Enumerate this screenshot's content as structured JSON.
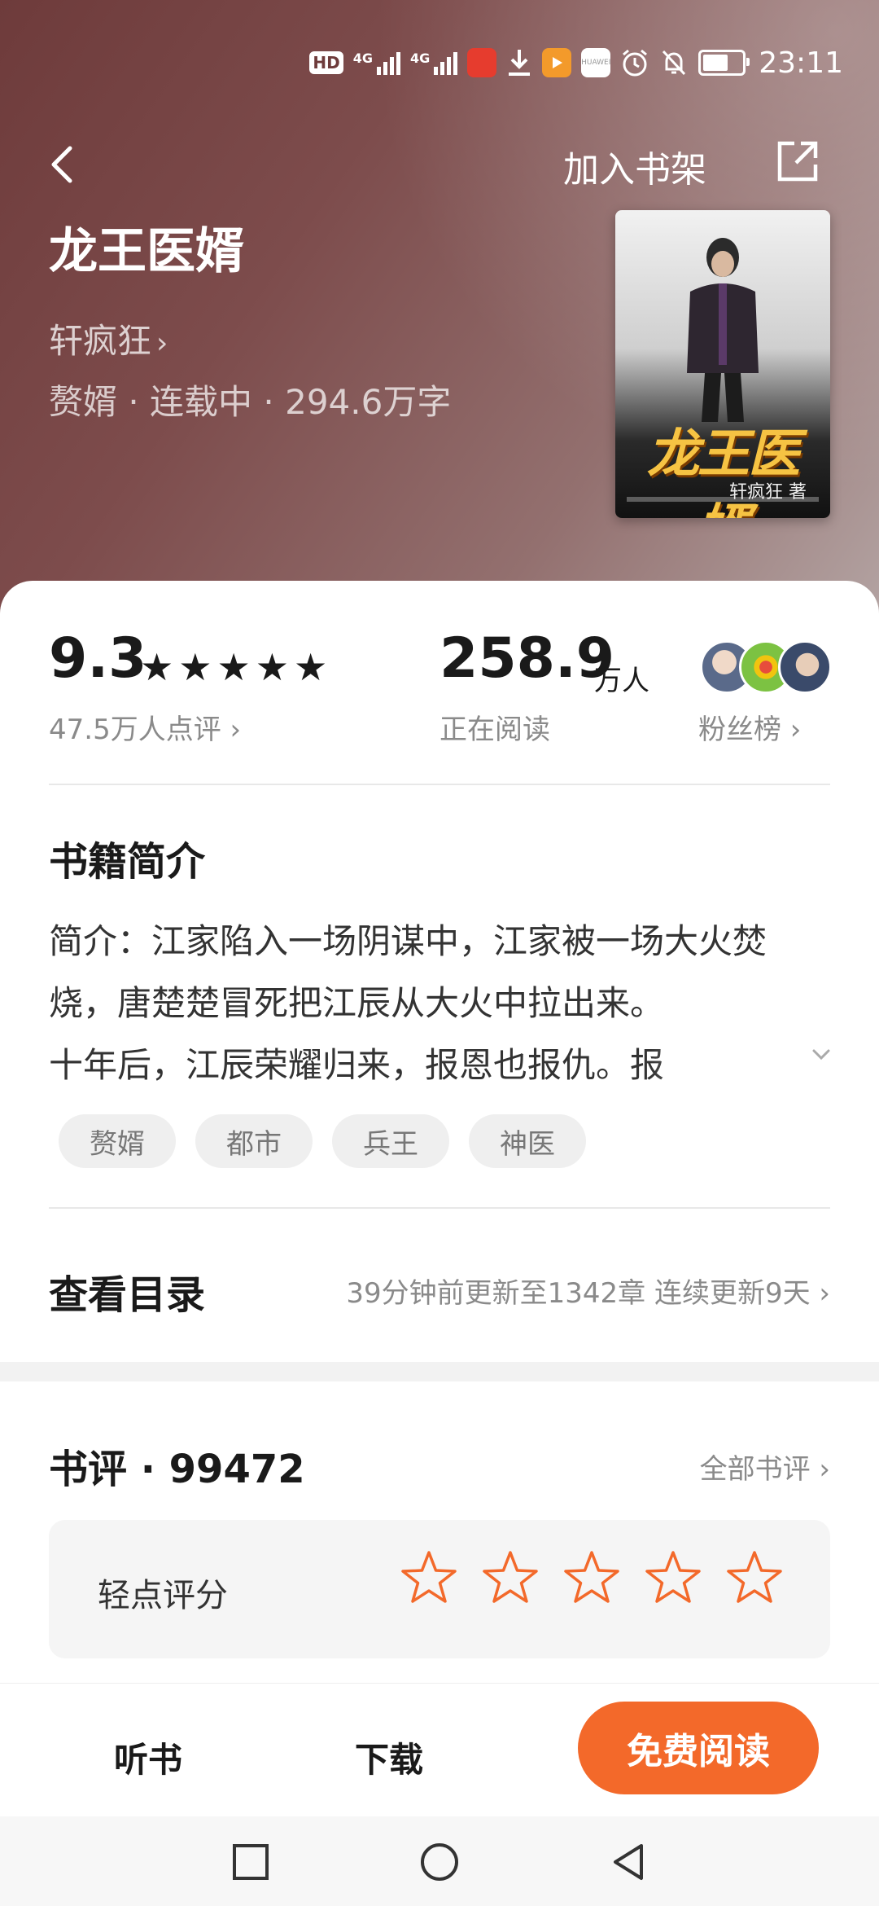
{
  "status_bar": {
    "time": "23:11",
    "hd_label": "HD",
    "network_1": "4G",
    "network_2": "4G",
    "huawei_label": "HUAWEI"
  },
  "header": {
    "back_icon": "chevron-left-icon",
    "add_to_shelf": "加入书架",
    "share_icon": "share-external-icon"
  },
  "book": {
    "title": "龙王医婿",
    "author": "轩疯狂",
    "author_chevron": "›",
    "meta": "赘婿 · 连载中 · 294.6万字",
    "cover": {
      "title": "龙王医婿",
      "author_line": "轩疯狂 著"
    }
  },
  "stats": {
    "score": "9.3",
    "stars": [
      "★",
      "★",
      "★",
      "★",
      "★"
    ],
    "reviews_count": "47.5万人点评 ›",
    "readers": "258.9",
    "readers_unit": "万人",
    "readers_label": "正在阅读",
    "fans_label": "粉丝榜 ›"
  },
  "intro": {
    "heading": "书籍简介",
    "lines": [
      "简介：江家陷入一场阴谋中，江家被一场大火焚",
      "烧，唐楚楚冒死把江辰从大火中拉出来。",
      "十年后，江辰荣耀归来，报恩也报仇。报"
    ]
  },
  "tags": [
    "赘婿",
    "都市",
    "兵王",
    "神医"
  ],
  "catalog": {
    "heading": "查看目录",
    "info": "39分钟前更新至1342章 连续更新9天 ›"
  },
  "reviews": {
    "heading": "书评 · 99472",
    "all_label": "全部书评 ›",
    "rate_label": "轻点评分"
  },
  "bottom_bar": {
    "listen": "听书",
    "download": "下载",
    "read_free": "免费阅读"
  },
  "colors": {
    "accent": "#f3692a",
    "hero_start": "#6e3b3b",
    "hero_end": "#b3a3a2",
    "muted_text": "#8a8a8a"
  }
}
